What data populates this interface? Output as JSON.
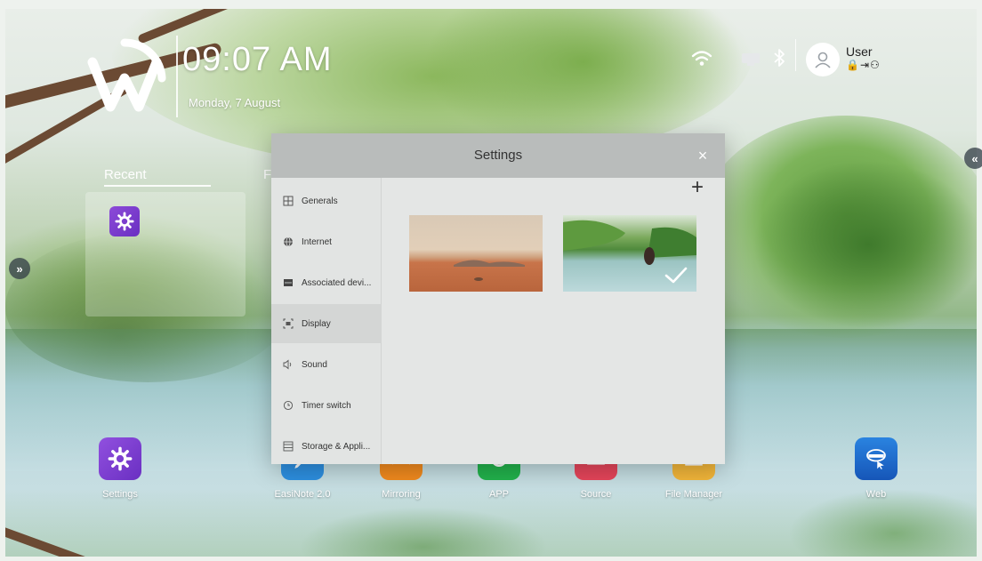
{
  "header": {
    "time": "09:07 AM",
    "date": "Monday, 7 August"
  },
  "status": {
    "icons": [
      "wifi-icon",
      "ethernet-icon",
      "bluetooth-icon"
    ],
    "user_name": "User",
    "user_actions": "🔒⇥⚇"
  },
  "edges": {
    "left_expand": "»",
    "right_expand": "«"
  },
  "home": {
    "tabs": [
      "Recent",
      "F"
    ],
    "recent_app_icon": "settings-icon"
  },
  "dock": {
    "apps": [
      {
        "label": "Settings",
        "icon": "settings-icon",
        "color": "#7b3fd0"
      },
      {
        "label": "EasiNote 2.0",
        "icon": "pen-icon",
        "color": "#2d8fe0"
      },
      {
        "label": "Mirroring",
        "icon": "mirroring-icon",
        "color": "#f08a1e"
      },
      {
        "label": "APP",
        "icon": "app-icon",
        "color": "#22b24c"
      },
      {
        "label": "Source",
        "icon": "source-icon",
        "color": "#e5455a"
      },
      {
        "label": "File Manager",
        "icon": "file-manager-icon",
        "color": "#f2b63a"
      },
      {
        "label": "Web",
        "icon": "web-icon",
        "color": "#1f6fd1"
      }
    ]
  },
  "settings": {
    "title": "Settings",
    "close": "×",
    "add": "+",
    "nav": [
      {
        "label": "Generals",
        "icon": "grid-icon"
      },
      {
        "label": "Internet",
        "icon": "globe-icon"
      },
      {
        "label": "Associated devi...",
        "icon": "device-icon"
      },
      {
        "label": "Display",
        "icon": "display-icon"
      },
      {
        "label": "Sound",
        "icon": "speaker-icon"
      },
      {
        "label": "Timer switch",
        "icon": "clock-icon"
      },
      {
        "label": "Storage & Appli...",
        "icon": "storage-icon"
      }
    ],
    "active_nav": "Display",
    "wallpapers": [
      {
        "name": "desert",
        "selected": false
      },
      {
        "name": "lake",
        "selected": true
      }
    ]
  }
}
